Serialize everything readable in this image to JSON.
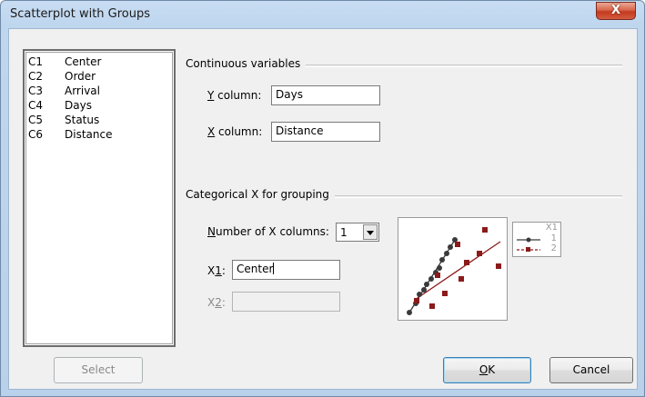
{
  "window": {
    "title": "Scatterplot with Groups",
    "close_symbol": "X"
  },
  "variables": [
    {
      "id": "C1",
      "name": "Center"
    },
    {
      "id": "C2",
      "name": "Order"
    },
    {
      "id": "C3",
      "name": "Arrival"
    },
    {
      "id": "C4",
      "name": "Days"
    },
    {
      "id": "C5",
      "name": "Status"
    },
    {
      "id": "C6",
      "name": "Distance"
    }
  ],
  "continuous": {
    "group_label": "Continuous variables",
    "y_label_mnemonic": "Y",
    "y_label_rest": " column:",
    "y_value": "Days",
    "x_label_mnemonic": "X",
    "x_label_rest": " column:",
    "x_value": "Distance"
  },
  "categorical": {
    "group_label": "Categorical X for grouping",
    "num_label_mnemonic": "N",
    "num_label_rest": "umber of X columns:",
    "num_value": "1",
    "x1_label_prefix": "X",
    "x1_label_mnemonic": "1",
    "x1_label_rest": ":",
    "x1_value": "Center",
    "x2_label_prefix": "X",
    "x2_label_mnemonic": "2",
    "x2_label_rest": ":",
    "x2_value": ""
  },
  "preview_legend": {
    "title": "X1",
    "item1": "1",
    "item2": "2"
  },
  "buttons": {
    "select": "Select",
    "ok_mnemonic": "O",
    "ok_rest": "K",
    "cancel": "Cancel"
  },
  "colors": {
    "series1": "#3a3a3a",
    "series2": "#8b1a1a",
    "accent_border": "#3c7fb1"
  }
}
